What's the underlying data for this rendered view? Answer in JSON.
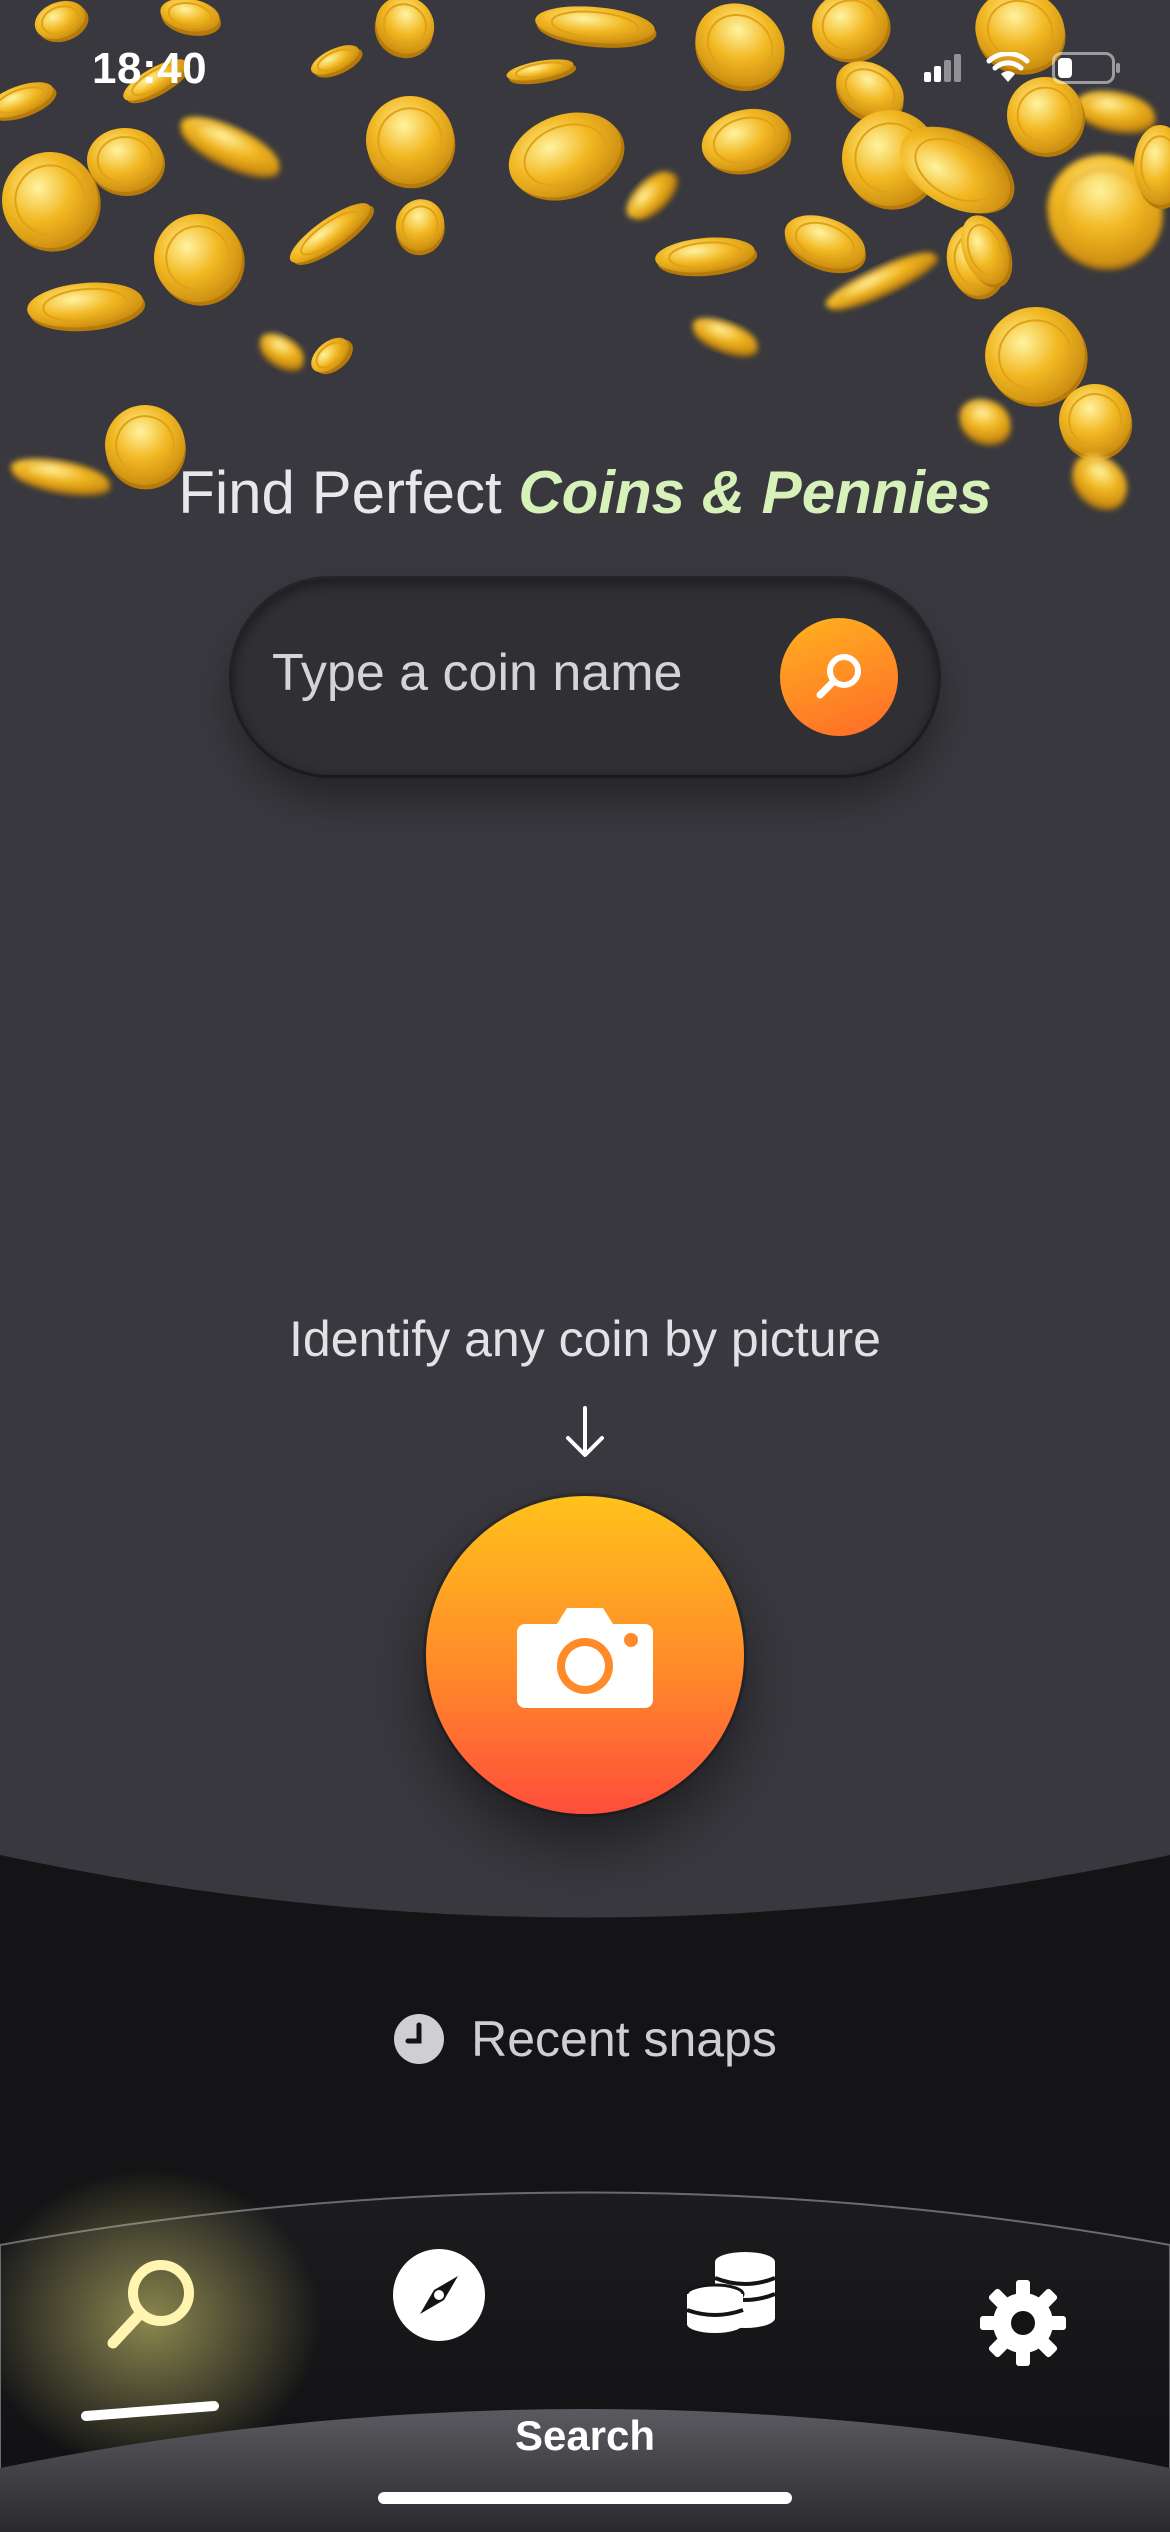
{
  "status_bar": {
    "time": "18:40"
  },
  "headline": {
    "prefix": "Find Perfect",
    "accent": "Coins & Pennies"
  },
  "search": {
    "placeholder": "Type a coin name"
  },
  "identify": {
    "label": "Identify any coin by picture"
  },
  "recent": {
    "label": "Recent snaps"
  },
  "tabs": [
    {
      "icon": "search-icon",
      "selected": true
    },
    {
      "icon": "compass-icon",
      "selected": false
    },
    {
      "icon": "coin-stack-icon",
      "selected": false
    },
    {
      "icon": "gear-icon",
      "selected": false
    }
  ],
  "active_tab_label": "Search",
  "colors": {
    "background": "#38383e",
    "dark_panel": "#141416",
    "accent_orange": "#ff8a2a",
    "accent_green": "#d6f2b8",
    "coin_gold": "#f2b823"
  }
}
